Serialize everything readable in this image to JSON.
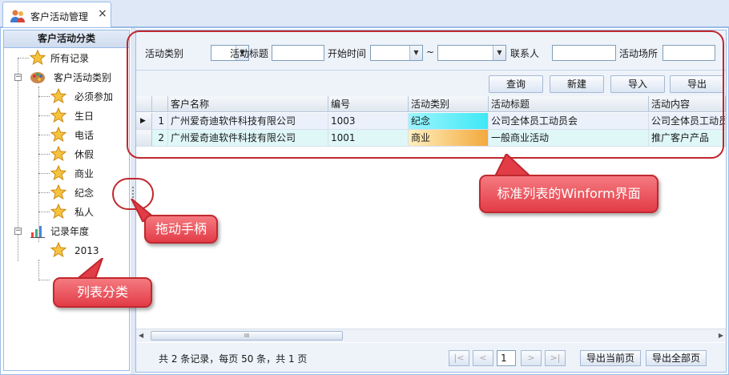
{
  "tab": {
    "title": "客户活动管理",
    "close": "×"
  },
  "leftpanel": {
    "title": "客户活动分类",
    "all_records": "所有记录",
    "category_group": "客户活动类别",
    "categories": [
      "必须参加",
      "生日",
      "电话",
      "休假",
      "商业",
      "纪念",
      "私人"
    ],
    "year_group": "记录年度",
    "years": [
      "2013"
    ]
  },
  "search": {
    "type_label": "活动类别",
    "title_label": "活动标题",
    "start_label": "开始时间",
    "tilde": "~",
    "contact_label": "联系人",
    "place_label": "活动场所"
  },
  "toolbar": {
    "query": "查询",
    "new": "新建",
    "import": "导入",
    "export": "导出"
  },
  "grid": {
    "columns": [
      "客户名称",
      "编号",
      "活动类别",
      "活动标题",
      "活动内容"
    ],
    "rows": [
      {
        "num": "1",
        "indicator": "▶",
        "customer": "广州爱奇迪软件科技有限公司",
        "code": "1003",
        "type": "纪念",
        "title": "公司全体员工动员会",
        "content": "公司全体员工动员"
      },
      {
        "num": "2",
        "indicator": "",
        "customer": "广州爱奇迪软件科技有限公司",
        "code": "1001",
        "type": "商业",
        "title": "一般商业活动",
        "content": "推广客户产品"
      }
    ],
    "scroll_grip": "III"
  },
  "pager": {
    "info": "共 2 条记录，每页 50 条，共 1 页",
    "first": "|<",
    "prev": "<",
    "page": "1",
    "next": ">",
    "last": ">|",
    "export_current": "导出当前页",
    "export_all": "导出全部页"
  },
  "annotations": {
    "drag_handle": "拖动手柄",
    "list_category": "列表分类",
    "standard_list": "标准列表的Winform界面"
  },
  "colors": {
    "accent_border": "#99bbe8",
    "header_bg": "#dfe8f6",
    "callout_red": "#e23c47",
    "anniversary_cell": "#3ee8f5",
    "business_cell": "#f3a93d"
  },
  "icons": {
    "tab": "users-icon",
    "all_records": "star-icon",
    "category_group": "palette-icon",
    "year_group": "chart-icon",
    "category_items": "star-icon"
  }
}
